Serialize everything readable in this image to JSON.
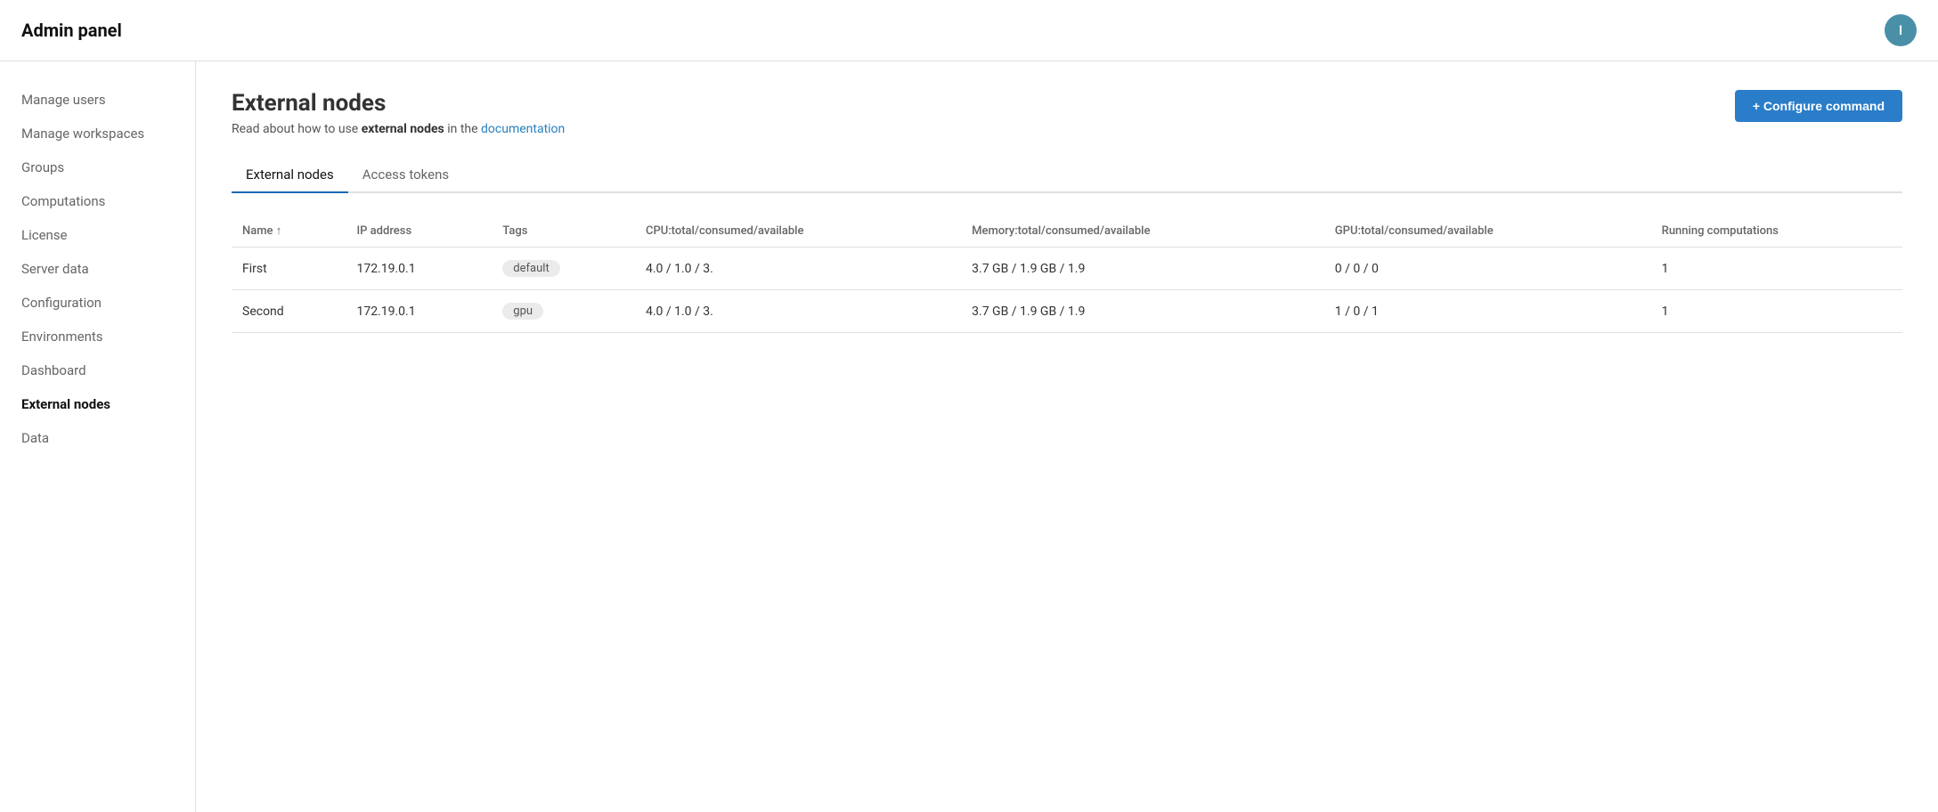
{
  "header": {
    "title": "Admin panel",
    "user_initial": "I"
  },
  "sidebar": {
    "items": [
      {
        "label": "Manage users",
        "id": "manage-users",
        "active": false
      },
      {
        "label": "Manage workspaces",
        "id": "manage-workspaces",
        "active": false
      },
      {
        "label": "Groups",
        "id": "groups",
        "active": false
      },
      {
        "label": "Computations",
        "id": "computations",
        "active": false
      },
      {
        "label": "License",
        "id": "license",
        "active": false
      },
      {
        "label": "Server data",
        "id": "server-data",
        "active": false
      },
      {
        "label": "Configuration",
        "id": "configuration",
        "active": false
      },
      {
        "label": "Environments",
        "id": "environments",
        "active": false
      },
      {
        "label": "Dashboard",
        "id": "dashboard",
        "active": false
      },
      {
        "label": "External nodes",
        "id": "external-nodes",
        "active": true
      },
      {
        "label": "Data",
        "id": "data",
        "active": false
      }
    ]
  },
  "page": {
    "title": "External nodes",
    "subtitle_prefix": "Read about how to use ",
    "subtitle_link_text": "external nodes",
    "subtitle_suffix": " in the ",
    "subtitle_doc_text": "documentation"
  },
  "configure_btn": {
    "label": "+ Configure command"
  },
  "tabs": [
    {
      "label": "External nodes",
      "active": true
    },
    {
      "label": "Access tokens",
      "active": false
    }
  ],
  "table": {
    "columns": [
      {
        "label": "Name",
        "sortable": true,
        "sort_arrow": "↑"
      },
      {
        "label": "IP address",
        "sortable": false
      },
      {
        "label": "Tags",
        "sortable": false
      },
      {
        "label": "CPU:total/consumed/available",
        "sortable": false
      },
      {
        "label": "Memory:total/consumed/available",
        "sortable": false
      },
      {
        "label": "GPU:total/consumed/available",
        "sortable": false
      },
      {
        "label": "Running computations",
        "sortable": false
      }
    ],
    "rows": [
      {
        "name": "First",
        "ip": "172.19.0.1",
        "tag": "default",
        "cpu": "4.0 / 1.0 / 3.",
        "memory": "3.7 GB / 1.9 GB / 1.9",
        "gpu": "0 / 0 / 0",
        "running": "1"
      },
      {
        "name": "Second",
        "ip": "172.19.0.1",
        "tag": "gpu",
        "cpu": "4.0 / 1.0 / 3.",
        "memory": "3.7 GB / 1.9 GB / 1.9",
        "gpu": "1 / 0 / 1",
        "running": "1"
      }
    ]
  }
}
